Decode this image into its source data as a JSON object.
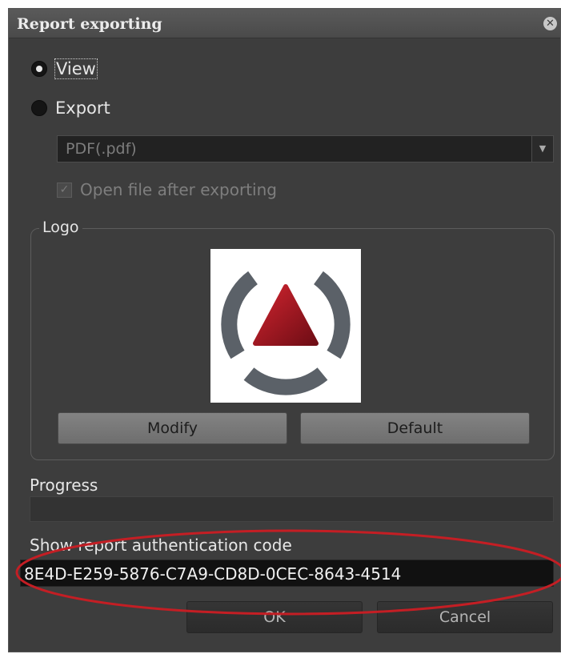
{
  "dialog": {
    "title": "Report exporting",
    "close_icon": "close-icon"
  },
  "mode": {
    "options": [
      {
        "label": "View",
        "checked": true
      },
      {
        "label": "Export",
        "checked": false
      }
    ]
  },
  "export": {
    "format_value": "PDF(.pdf)",
    "format_dropdown_icon": "chevron-down-icon",
    "open_file_label": "Open file after exporting",
    "open_file_checked": true,
    "disabled": true
  },
  "logo": {
    "legend": "Logo",
    "modify_label": "Modify",
    "default_label": "Default",
    "colors": {
      "ring": "#5b6168",
      "triangle_top": "#c8202c",
      "triangle_bottom": "#7a0f17"
    }
  },
  "progress": {
    "label": "Progress",
    "value": 0
  },
  "auth": {
    "label": "Show report authentication code",
    "code": "8E4D-E259-5876-C7A9-CD8D-0CEC-8643-4514"
  },
  "footer": {
    "ok_label": "OK",
    "cancel_label": "Cancel"
  },
  "annotation": {
    "color": "#c41e24"
  }
}
